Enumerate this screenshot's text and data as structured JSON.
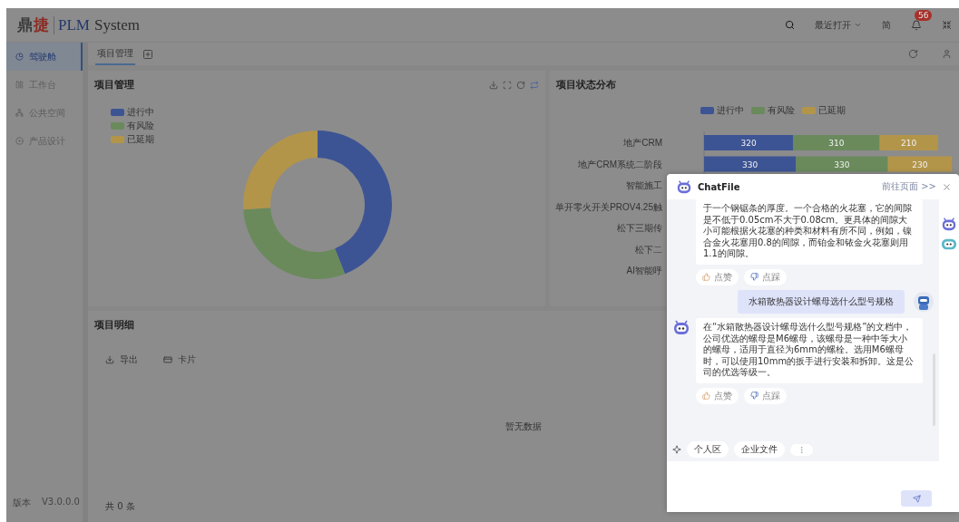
{
  "header": {
    "logo": {
      "cn_left": "鼎",
      "cn_right": "捷",
      "en": "PLM",
      "suffix": "System"
    },
    "recent": "最近打开",
    "language": "简",
    "badge": "56"
  },
  "sidebar": {
    "items": [
      {
        "label": "驾驶舱",
        "selected": true
      },
      {
        "label": "工作台",
        "selected": false
      },
      {
        "label": "公共空间",
        "selected": false
      },
      {
        "label": "产品设计",
        "selected": false
      }
    ],
    "version_label": "版本",
    "version": "V3.0.0.0"
  },
  "tabs": [
    {
      "label": "项目管理",
      "selected": true
    }
  ],
  "donut_panel": {
    "title": "项目管理",
    "legend": [
      {
        "label": "进行中",
        "color": "#3d5494"
      },
      {
        "label": "有风险",
        "color": "#6a8a5c"
      },
      {
        "label": "已延期",
        "color": "#b3954a"
      }
    ]
  },
  "bar_panel": {
    "title": "项目状态分布",
    "chart_data": {
      "type": "bar",
      "orientation": "horizontal",
      "stacked": true,
      "data_labels": true,
      "categories": [
        "地产CRM",
        "地产CRM系统二阶段",
        "智能施工",
        "单开零火开关PROV4.25触",
        "松下三期传",
        "松下二",
        "AI智能呼"
      ],
      "series": [
        {
          "name": "进行中",
          "color": "#3d5494",
          "values": [
            320,
            330,
            null,
            null,
            null,
            null,
            null
          ]
        },
        {
          "name": "有风险",
          "color": "#6a8a5c",
          "values": [
            310,
            330,
            null,
            null,
            null,
            null,
            null
          ]
        },
        {
          "name": "已延期",
          "color": "#b3954a",
          "values": [
            210,
            230,
            null,
            null,
            null,
            null,
            null
          ]
        }
      ]
    }
  },
  "detail_panel": {
    "title": "项目明细",
    "actions": [
      "导出",
      "卡片"
    ],
    "empty": "暂无数据",
    "total": "共 0 条"
  },
  "chat": {
    "title": "ChatFile",
    "goto": "前往页面 >>",
    "messages": [
      {
        "kind": "bot",
        "avatar": false,
        "text": "于一个钢锯条的厚度。一个合格的火花塞，它的间隙是不低于0.05cm不大于0.08cm。更具体的间隙大小可能根据火花塞的种类和材料有所不同，例如，镍合金火花塞用0.8的间隙，而铂金和铱金火花塞则用1.1的间隙。",
        "like": "点赞",
        "dislike": "点踩"
      },
      {
        "kind": "user",
        "text": "水箱散热器设计螺母选什么型号规格"
      },
      {
        "kind": "bot",
        "avatar": true,
        "text": "在“水箱散热器设计螺母选什么型号规格”的文档中，公司优选的螺母是M6螺母，该螺母是一种中等大小的螺母，适用于直径为6mm的螺栓。选用M6螺母时，可以使用10mm的扳手进行安装和拆卸。这是公司的优选等级一。",
        "like": "点赞",
        "dislike": "点踩"
      }
    ],
    "chips": [
      "个人区",
      "企业文件"
    ]
  }
}
